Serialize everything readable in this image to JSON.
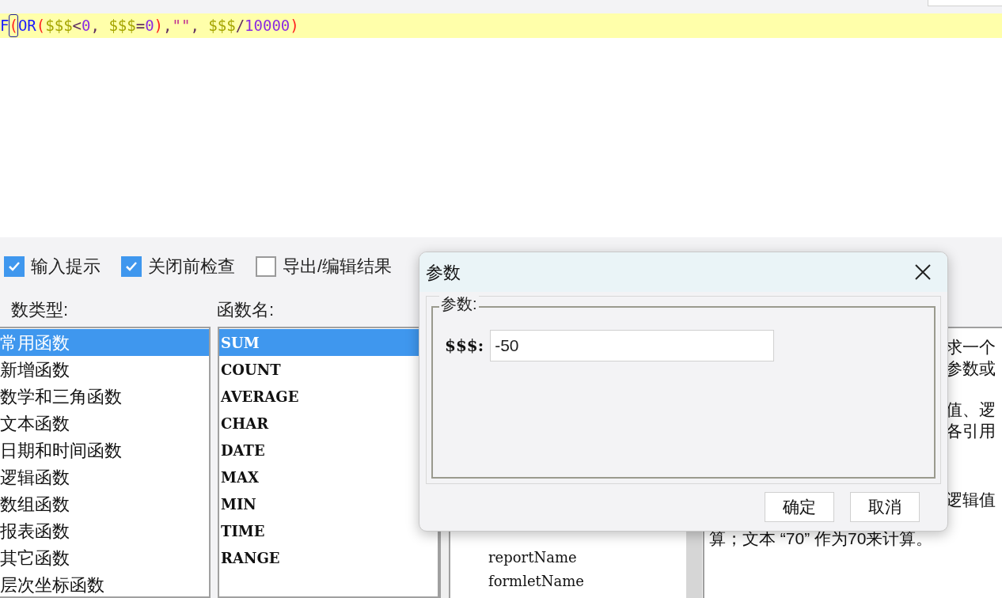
{
  "editor": {
    "tokens": [
      {
        "text": "F",
        "kind": "keyword",
        "cursor": false
      },
      {
        "text": "(",
        "kind": "paren",
        "cursor": true
      },
      {
        "text": "OR",
        "kind": "keyword",
        "cursor": false
      },
      {
        "text": "(",
        "kind": "paren",
        "cursor": false
      },
      {
        "text": "$$$",
        "kind": "param",
        "cursor": false
      },
      {
        "text": "<",
        "kind": "op",
        "cursor": false
      },
      {
        "text": "0",
        "kind": "number",
        "cursor": false
      },
      {
        "text": ", ",
        "kind": "op",
        "cursor": false
      },
      {
        "text": "$$$",
        "kind": "param",
        "cursor": false
      },
      {
        "text": "=",
        "kind": "op",
        "cursor": false
      },
      {
        "text": "0",
        "kind": "number",
        "cursor": false
      },
      {
        "text": ")",
        "kind": "paren",
        "cursor": false
      },
      {
        "text": ",",
        "kind": "op",
        "cursor": false
      },
      {
        "text": "\"\"",
        "kind": "string",
        "cursor": false
      },
      {
        "text": ", ",
        "kind": "op",
        "cursor": false
      },
      {
        "text": "$$$",
        "kind": "param",
        "cursor": false
      },
      {
        "text": "/",
        "kind": "op",
        "cursor": false
      },
      {
        "text": "10000",
        "kind": "number",
        "cursor": false
      },
      {
        "text": ")",
        "kind": "paren",
        "cursor": false
      }
    ]
  },
  "options": [
    {
      "label": "输入提示",
      "checked": true
    },
    {
      "label": "关闭前检查",
      "checked": true
    },
    {
      "label": "导出/编辑结果",
      "checked": false
    }
  ],
  "function_types": {
    "label": "数类型:",
    "items": [
      {
        "label": "常用函数",
        "selected": true
      },
      {
        "label": "新增函数",
        "selected": false
      },
      {
        "label": "数学和三角函数",
        "selected": false
      },
      {
        "label": "文本函数",
        "selected": false
      },
      {
        "label": "日期和时间函数",
        "selected": false
      },
      {
        "label": "逻辑函数",
        "selected": false
      },
      {
        "label": "数组函数",
        "selected": false
      },
      {
        "label": "报表函数",
        "selected": false
      },
      {
        "label": "其它函数",
        "selected": false
      },
      {
        "label": "层次坐标函数",
        "selected": false
      }
    ]
  },
  "function_names": {
    "label": "函数名:",
    "items": [
      {
        "label": "SUM",
        "selected": true
      },
      {
        "label": "COUNT",
        "selected": false
      },
      {
        "label": "AVERAGE",
        "selected": false
      },
      {
        "label": "CHAR",
        "selected": false
      },
      {
        "label": "DATE",
        "selected": false
      },
      {
        "label": "MAX",
        "selected": false
      },
      {
        "label": "MIN",
        "selected": false
      },
      {
        "label": "TIME",
        "selected": false
      },
      {
        "label": "RANGE",
        "selected": false
      }
    ]
  },
  "variables_tree": {
    "items": [
      "reportName",
      "formletName"
    ]
  },
  "description": {
    "fragments": [
      "求一个",
      "参数或",
      "值、逻",
      "各引用",
      "逻辑值"
    ],
    "last_line": "算；文本 “70” 作为70来计算。"
  },
  "dialog": {
    "title": "参数",
    "group_label": "参数:",
    "field_label": "$$$:",
    "field_value": "-50",
    "buttons": [
      "确定",
      "取消"
    ]
  }
}
